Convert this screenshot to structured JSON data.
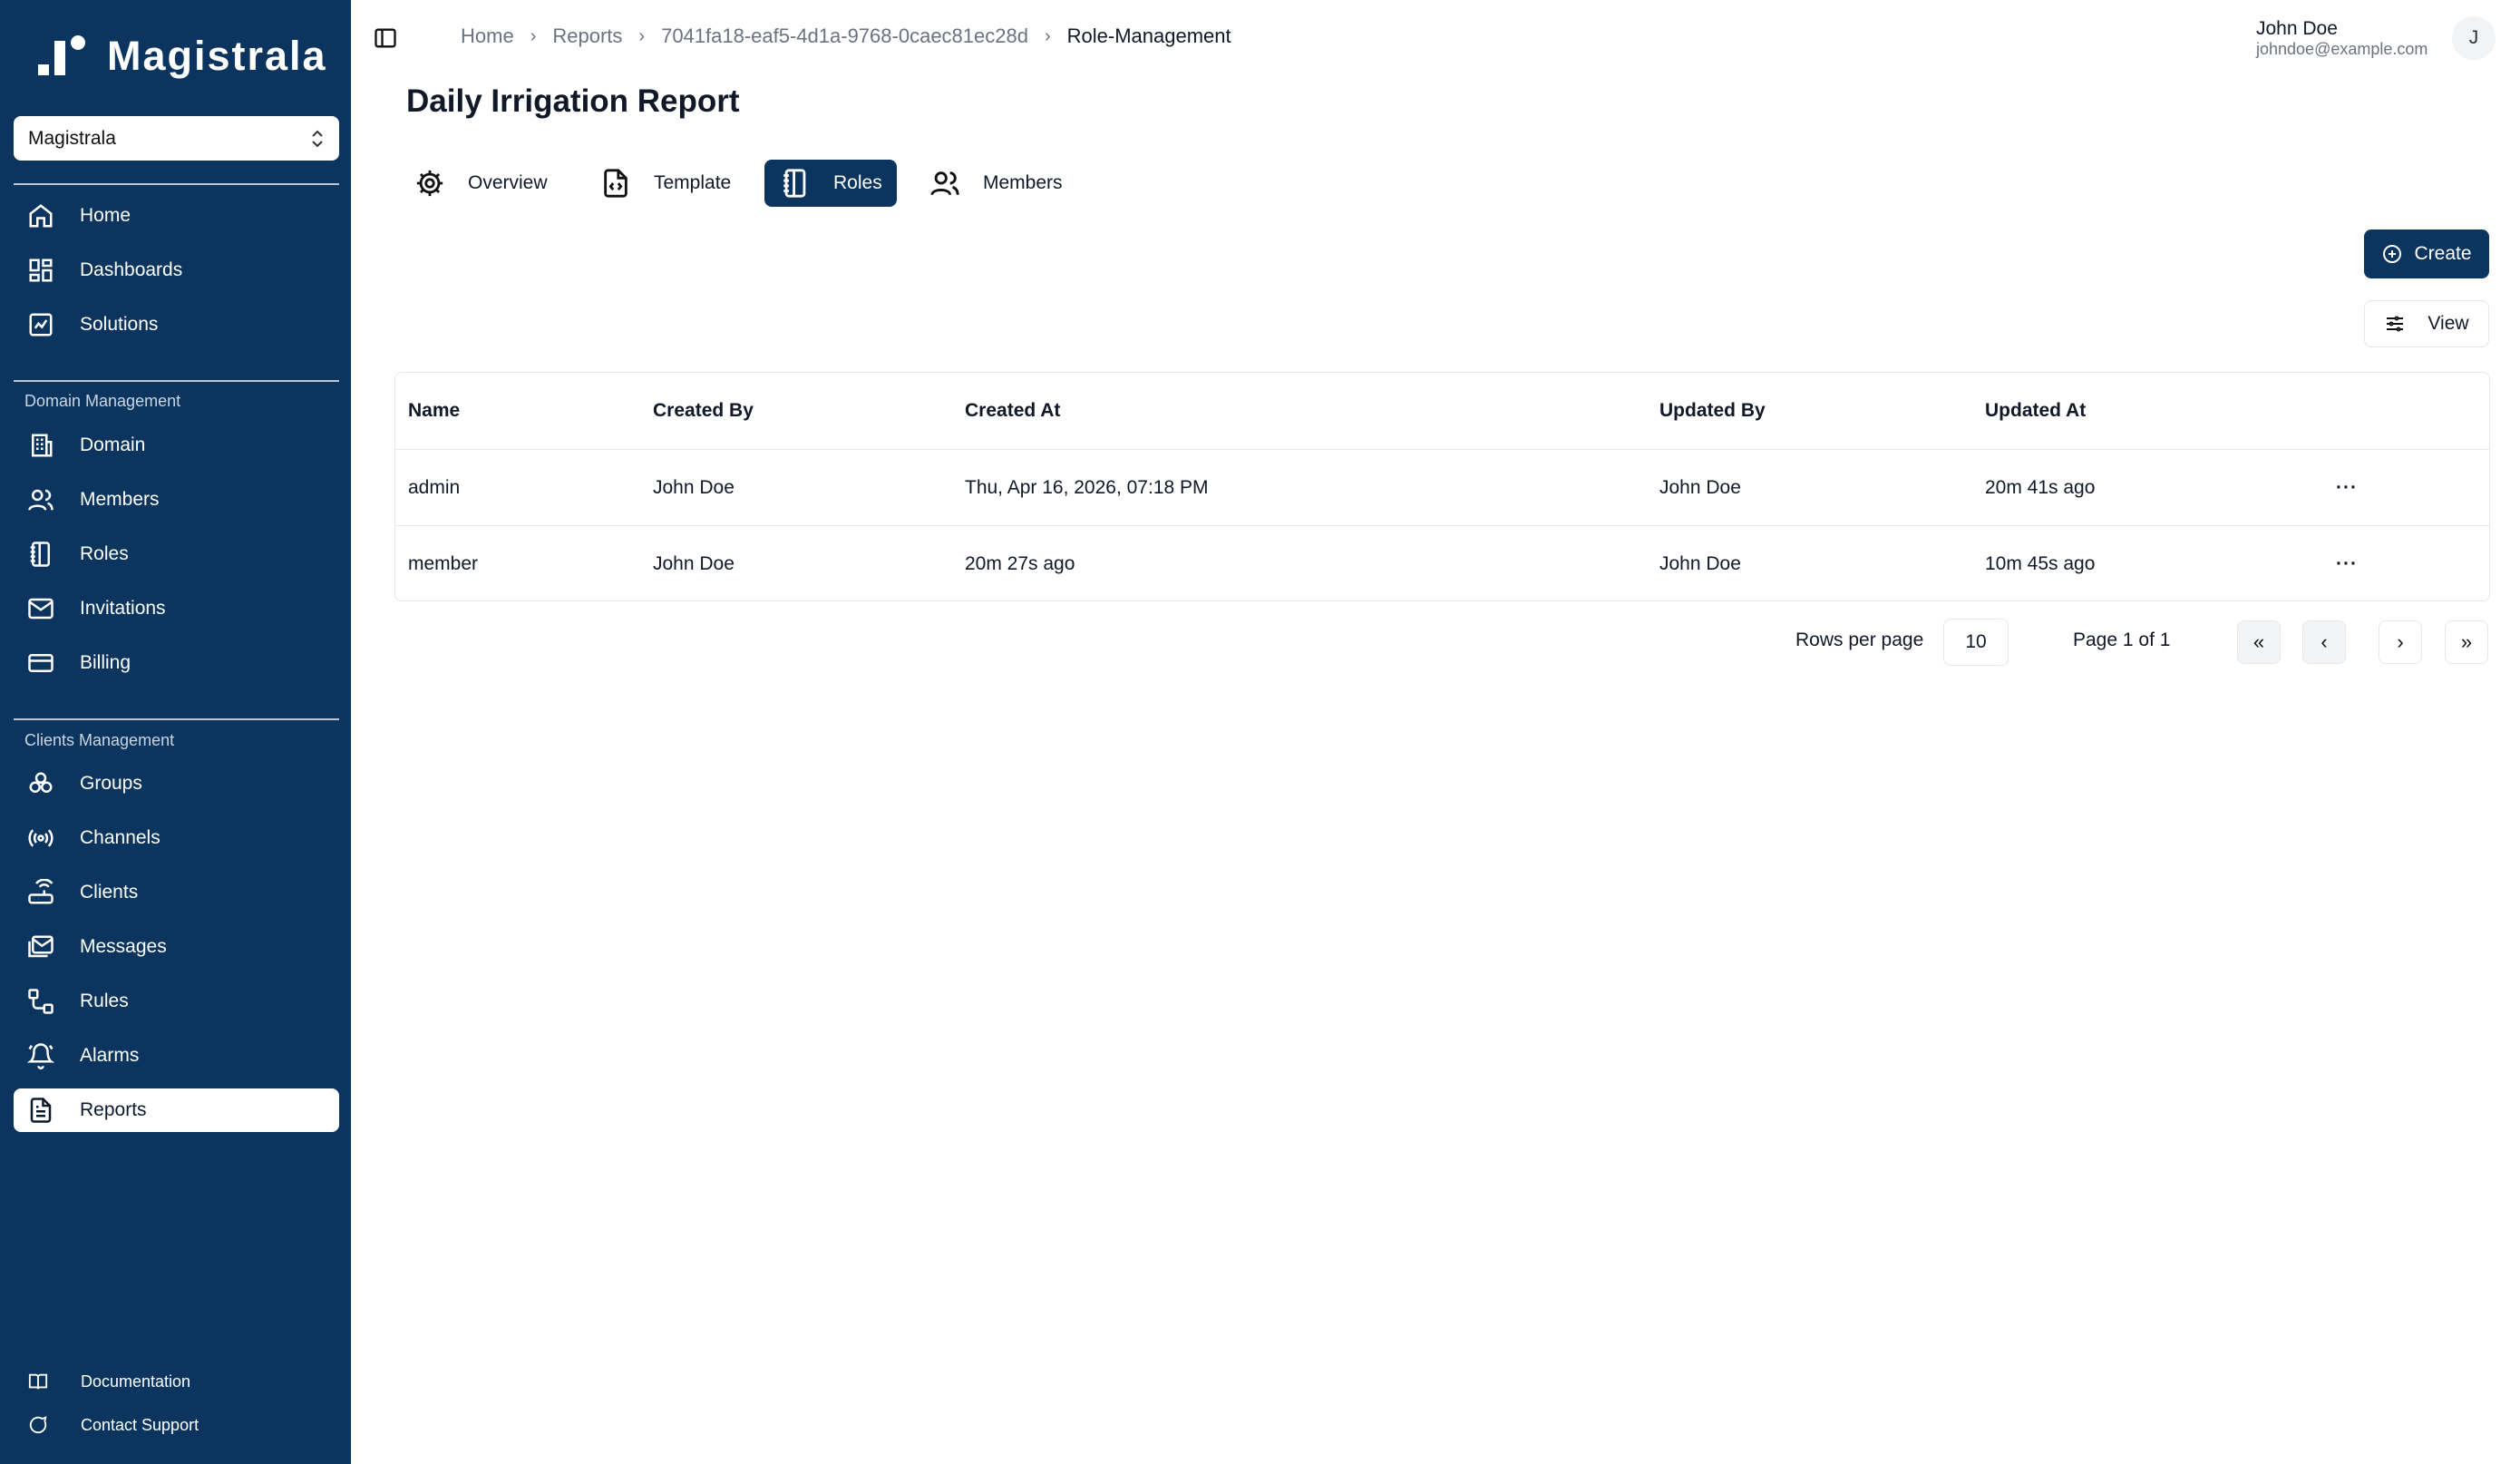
{
  "app": {
    "name": "Magistrala"
  },
  "domain_selector": {
    "value": "Magistrala"
  },
  "sidebar": {
    "main_items": [
      {
        "label": "Home",
        "icon": "home-icon"
      },
      {
        "label": "Dashboards",
        "icon": "dashboard-icon"
      },
      {
        "label": "Solutions",
        "icon": "solutions-icon"
      }
    ],
    "domain_group_label": "Domain Management",
    "domain_items": [
      {
        "label": "Domain",
        "icon": "building-icon"
      },
      {
        "label": "Members",
        "icon": "users-icon"
      },
      {
        "label": "Roles",
        "icon": "notebook-icon"
      },
      {
        "label": "Invitations",
        "icon": "mail-icon"
      },
      {
        "label": "Billing",
        "icon": "credit-card-icon"
      }
    ],
    "clients_group_label": "Clients Management",
    "clients_items": [
      {
        "label": "Groups",
        "icon": "groups-icon"
      },
      {
        "label": "Channels",
        "icon": "radio-icon"
      },
      {
        "label": "Clients",
        "icon": "router-icon"
      },
      {
        "label": "Messages",
        "icon": "messages-icon"
      },
      {
        "label": "Rules",
        "icon": "rules-icon"
      },
      {
        "label": "Alarms",
        "icon": "bell-icon"
      },
      {
        "label": "Reports",
        "icon": "file-text-icon",
        "active": true
      }
    ],
    "footer_items": [
      {
        "label": "Documentation",
        "icon": "book-icon"
      },
      {
        "label": "Contact Support",
        "icon": "chat-icon"
      }
    ]
  },
  "breadcrumb": [
    "Home",
    "Reports",
    "7041fa18-eaf5-4d1a-9768-0caec81ec28d",
    "Role-Management"
  ],
  "user": {
    "name": "John Doe",
    "email": "johndoe@example.com",
    "initial": "J"
  },
  "page": {
    "title": "Daily Irrigation Report"
  },
  "tabs": [
    {
      "label": "Overview",
      "icon": "gear-icon"
    },
    {
      "label": "Template",
      "icon": "file-code-icon"
    },
    {
      "label": "Roles",
      "icon": "notebook-icon",
      "active": true
    },
    {
      "label": "Members",
      "icon": "users-icon"
    }
  ],
  "actions": {
    "create_label": "Create",
    "view_label": "View"
  },
  "table": {
    "headers": [
      "Name",
      "Created By",
      "Created At",
      "Updated By",
      "Updated At"
    ],
    "rows": [
      {
        "name": "admin",
        "created_by": "John Doe",
        "created_at": "Thu, Apr 16, 2026, 07:18 PM",
        "updated_by": "John Doe",
        "updated_at": "20m 41s ago",
        "menu": "···"
      },
      {
        "name": "member",
        "created_by": "John Doe",
        "created_at": "20m 27s ago",
        "updated_by": "John Doe",
        "updated_at": "10m 45s ago",
        "menu": "···"
      }
    ]
  },
  "pagination": {
    "rows_per_page_label": "Rows per page",
    "rows_per_page": "10",
    "page_info": "Page 1 of 1",
    "first": "«",
    "prev": "‹",
    "next": "›",
    "last": "»"
  },
  "colors": {
    "sidebar_bg": "#0b355f",
    "accent": "#0b355f"
  }
}
